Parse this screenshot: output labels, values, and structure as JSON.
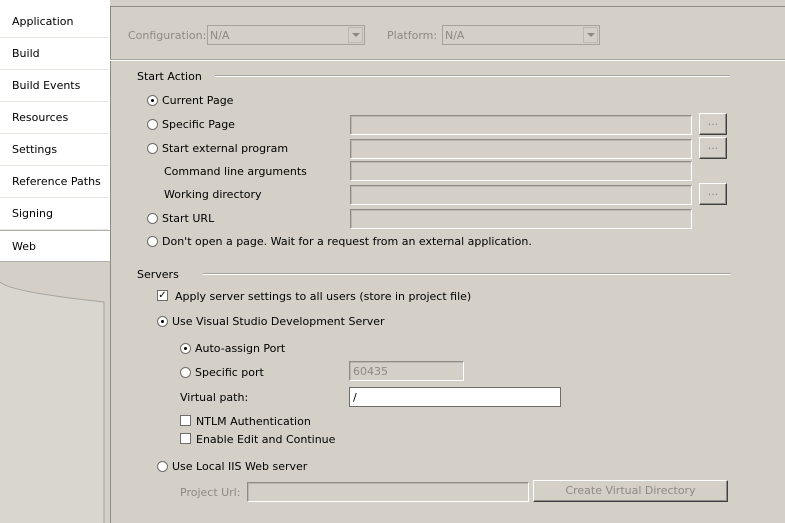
{
  "sidebar": {
    "tabs": [
      {
        "label": "Application"
      },
      {
        "label": "Build"
      },
      {
        "label": "Build Events"
      },
      {
        "label": "Resources"
      },
      {
        "label": "Settings"
      },
      {
        "label": "Reference Paths"
      },
      {
        "label": "Signing"
      },
      {
        "label": "Web"
      }
    ],
    "selected": "Web"
  },
  "header": {
    "configuration_label": "Configuration:",
    "configuration_value": "N/A",
    "platform_label": "Platform:",
    "platform_value": "N/A"
  },
  "start_action": {
    "group_label": "Start Action",
    "current_page": "Current Page",
    "specific_page": "Specific Page",
    "start_external_program": "Start external program",
    "command_line_arguments": "Command line arguments",
    "working_directory": "Working directory",
    "start_url": "Start URL",
    "dont_open": "Don't open a page.  Wait for a request from an external application.",
    "browse_label": "..."
  },
  "servers": {
    "group_label": "Servers",
    "apply_settings": "Apply server settings to all users (store in project file)",
    "use_vs_dev_server": "Use Visual Studio Development Server",
    "auto_assign_port": "Auto-assign Port",
    "specific_port": "Specific port",
    "specific_port_value": "60435",
    "virtual_path_label": "Virtual path:",
    "virtual_path_value": "/",
    "ntlm_auth": "NTLM Authentication",
    "enable_edit_continue": "Enable Edit and Continue",
    "use_local_iis": "Use Local IIS Web server",
    "project_url_label": "Project Url:",
    "create_virtual_directory": "Create Virtual Directory"
  }
}
